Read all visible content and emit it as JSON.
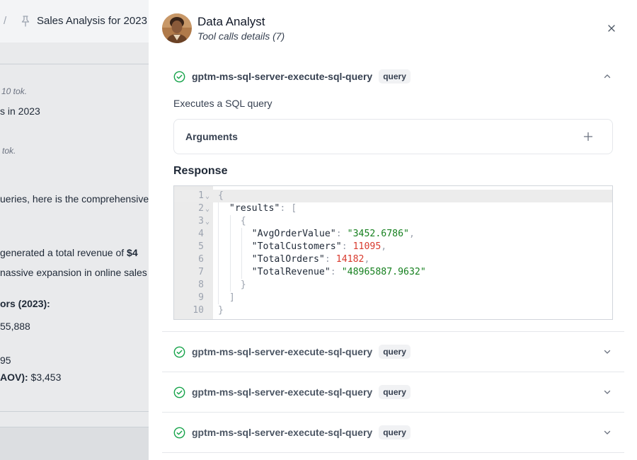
{
  "background": {
    "breadcrumb_separator": "/",
    "chat_title": "Sales Analysis for 2023",
    "token_meta_1": "10 tok.",
    "text_line_1": "s in 2023",
    "token_meta_2": "tok.",
    "text_line_2": "ueries, here is the comprehensive",
    "text_line_3a": " generated a total revenue of ",
    "text_line_3b": "$4",
    "text_line_4": "nassive expansion in online sales",
    "text_line_5": "ors (2023):",
    "text_line_6": "55,888",
    "text_line_7": "95",
    "text_line_8a": "AOV):",
    "text_line_8b": " $3,453"
  },
  "drawer": {
    "agent_name": "Data Analyst",
    "subtitle": "Tool calls details (7)",
    "icons": {
      "close": "close-icon",
      "success": "check-circle-icon",
      "expand": "chevron-down-icon",
      "collapse": "chevron-up-icon",
      "add": "plus-icon"
    },
    "tool_calls": [
      {
        "name": "gptm-ms-sql-server-execute-sql-query",
        "badge": "query",
        "expanded": true,
        "description": "Executes a SQL query",
        "arguments_label": "Arguments",
        "response_label": "Response",
        "response": {
          "lines": [
            {
              "num": "1",
              "fold": "⌄",
              "text": "{"
            },
            {
              "num": "2",
              "fold": "⌄",
              "text": "\"results\": ["
            },
            {
              "num": "3",
              "fold": "⌄",
              "text": "{"
            },
            {
              "num": "4",
              "text": "\"AvgOrderValue\": \"3452.6786\","
            },
            {
              "num": "5",
              "text": "\"TotalCustomers\": 11095,"
            },
            {
              "num": "6",
              "text": "\"TotalOrders\": 14182,"
            },
            {
              "num": "7",
              "text": "\"TotalRevenue\": \"48965887.9632\""
            },
            {
              "num": "8",
              "text": "}"
            },
            {
              "num": "9",
              "text": "]"
            },
            {
              "num": "10",
              "text": "}"
            }
          ],
          "keys": [
            "\"results\"",
            "\"AvgOrderValue\"",
            "\"TotalCustomers\"",
            "\"TotalOrders\"",
            "\"TotalRevenue\""
          ],
          "values": [
            "\"3452.6786\"",
            "11095",
            "14182",
            "\"48965887.9632\""
          ]
        }
      },
      {
        "name": "gptm-ms-sql-server-execute-sql-query",
        "badge": "query",
        "expanded": false
      },
      {
        "name": "gptm-ms-sql-server-execute-sql-query",
        "badge": "query",
        "expanded": false
      },
      {
        "name": "gptm-ms-sql-server-execute-sql-query",
        "badge": "query",
        "expanded": false
      }
    ]
  },
  "colors": {
    "success_green": "#16a34a",
    "json_string": "#16801f",
    "json_number": "#d83a2e",
    "overlay": "#e9eaec"
  }
}
